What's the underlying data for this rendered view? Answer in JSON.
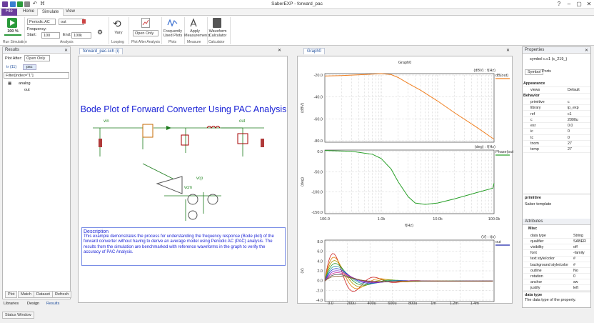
{
  "window": {
    "title": "SaberEXP - forward_pac",
    "quick_access_glyph": "⌘"
  },
  "ribbon_tabs": [
    "File",
    "Home",
    "Simulate",
    "View"
  ],
  "ribbon": {
    "run": {
      "percent": "100 %",
      "group": "Run Simulation"
    },
    "analysis": {
      "type": "Periodic AC",
      "signal": "out",
      "frequency_label": "Frequency:",
      "start_label": "Start:",
      "start_value": "100",
      "end_label": "End:",
      "end_value": "100k",
      "group": "Analysis"
    },
    "looping": {
      "label": "Vary",
      "group": "Looping"
    },
    "plot_after": {
      "value": "Open Only",
      "group": "Plot After Analysis"
    },
    "plots": {
      "label1": "Frequently",
      "label2": "Used Plots",
      "group": "Plots"
    },
    "measure": {
      "label1": "Apply",
      "label2": "Measurements",
      "group": "Measure"
    },
    "calc": {
      "label1": "Waveform",
      "label2": "Calculator",
      "group": "Calculator"
    }
  },
  "results": {
    "title": "Results",
    "plot_after_label": "Plot After:",
    "plot_after_value": "Open Only",
    "tabs": [
      "tr (11)",
      "psc"
    ],
    "filter": "Filter[index=\"1\"]",
    "tree_root": "analog",
    "tree_child": "out",
    "bottom_tabs": [
      "Plot",
      "Match",
      "Dataset",
      "Refresh"
    ]
  },
  "bottom_tabs": [
    "Libraries",
    "Design",
    "Results"
  ],
  "status_window": "Status Window",
  "schematic": {
    "tab": "forward_pac.sch (i)",
    "title": "Bode Plot of Forward Converter Using PAC Analysis",
    "vin": "vin",
    "out": "out",
    "vcp": "vcp",
    "vcm": "vcm",
    "desc_title": "Description",
    "desc_text": "This example demonstrates the process for understanding the  frequency response (Bode plot) of the forward converter without  having to derive an average model using Periodic AC (PAC) analysis. The results from the simulation are benchmarked with reference waveforms in the graph to verify the accuracy of PAC Analysis."
  },
  "graph": {
    "tab": "Graph0",
    "title": "Graph0",
    "top": {
      "units": "(dBV) : f(Hz)",
      "legend": "dB(out)",
      "ylabel": "(dBV)",
      "yticks": [
        "-20.0",
        "-40.0",
        "-60.0",
        "-80.0"
      ]
    },
    "mid": {
      "units": "(deg) : f(Hz)",
      "legend": "Phase(out)",
      "ylabel": "(deg)",
      "yticks": [
        "0.0",
        "-50.0",
        "-100.0",
        "-150.0"
      ],
      "xticks": [
        "100.0",
        "1.0k",
        "10.0k",
        "100.0k"
      ],
      "xlabel": "f(Hz)"
    },
    "bot": {
      "units": "(V) : t(s)",
      "legend": "out",
      "ylabel": "(V)",
      "yticks": [
        "8.0",
        "6.0",
        "4.0",
        "2.0",
        "0.0",
        "-2.0",
        "-4.0"
      ],
      "xticks": [
        "0.0",
        "200u",
        "400u",
        "600u",
        "800u",
        "1m",
        "1.2m",
        "1.4m"
      ],
      "xlabel": "t(s)"
    }
  },
  "chart_data": [
    {
      "type": "line",
      "title": "Graph0",
      "xlabel": "f(Hz)",
      "ylabel": "(dBV)",
      "x_scale": "log",
      "xlim": [
        100,
        100000
      ],
      "ylim": [
        -90,
        -20
      ],
      "grid": true,
      "series": [
        {
          "name": "dB(out)",
          "color": "#f07f1f",
          "x": [
            100,
            200,
            500,
            1000,
            1500,
            2000,
            3000,
            5000,
            10000,
            20000,
            50000,
            100000
          ],
          "y": [
            -22.5,
            -22,
            -21,
            -20,
            -21,
            -24,
            -30,
            -37,
            -48,
            -60,
            -75,
            -87
          ]
        }
      ]
    },
    {
      "type": "line",
      "xlabel": "f(Hz)",
      "ylabel": "(deg)",
      "x_scale": "log",
      "xlim": [
        100,
        100000
      ],
      "ylim": [
        -150,
        0
      ],
      "grid": true,
      "series": [
        {
          "name": "Phase(out)",
          "color": "#2aa02a",
          "x": [
            100,
            300,
            700,
            1000,
            1500,
            2000,
            3000,
            4000,
            6000,
            10000,
            20000,
            50000,
            95000,
            100000
          ],
          "y": [
            -1,
            -3,
            -10,
            -20,
            -45,
            -75,
            -110,
            -125,
            -128,
            -125,
            -115,
            -100,
            -90,
            -78
          ]
        }
      ]
    },
    {
      "type": "line",
      "xlabel": "t(s)",
      "ylabel": "(V)",
      "xlim": [
        0,
        0.0015
      ],
      "ylim": [
        -4,
        8
      ],
      "grid": true,
      "series": [
        {
          "name": "out",
          "color": "#cc2222"
        }
      ],
      "note": "family of damped step responses, peak ~7V near 100u, settling to ~0V"
    }
  ],
  "properties": {
    "title": "Properties",
    "symbol": "symbol c.c1 (c_219_)",
    "tabs": [
      "Symbol",
      "Ports"
    ],
    "sections": [
      {
        "name": "Appearance",
        "rows": [
          [
            "views",
            "Default"
          ]
        ]
      },
      {
        "name": "Behavior",
        "rows": [
          [
            "primitive",
            "c"
          ],
          [
            "library",
            "ip_exp"
          ],
          [
            "ref",
            "c1"
          ],
          [
            "c",
            "2000u"
          ],
          [
            "esr",
            "0.0"
          ],
          [
            "ic",
            "0"
          ],
          [
            "tc",
            "0"
          ],
          [
            "tnom",
            "27"
          ],
          [
            "temp",
            "27"
          ]
        ]
      }
    ],
    "primitive_label": "primitive",
    "primitive_desc": "Saber template",
    "attributes_title": "Attributes",
    "misc": "Misc",
    "attr_rows": [
      [
        "data type",
        "String"
      ],
      [
        "qualifier",
        "SABER"
      ],
      [
        "visibility",
        "off"
      ],
      [
        "font",
        "-family"
      ],
      [
        "text style/color",
        "#"
      ],
      [
        "background style/color",
        "#"
      ],
      [
        "outline",
        "No"
      ],
      [
        "rotation",
        "0"
      ],
      [
        "anchor",
        "sw"
      ],
      [
        "justify",
        "left"
      ]
    ],
    "help_title": "data type",
    "help_text": "The data type of the property."
  }
}
